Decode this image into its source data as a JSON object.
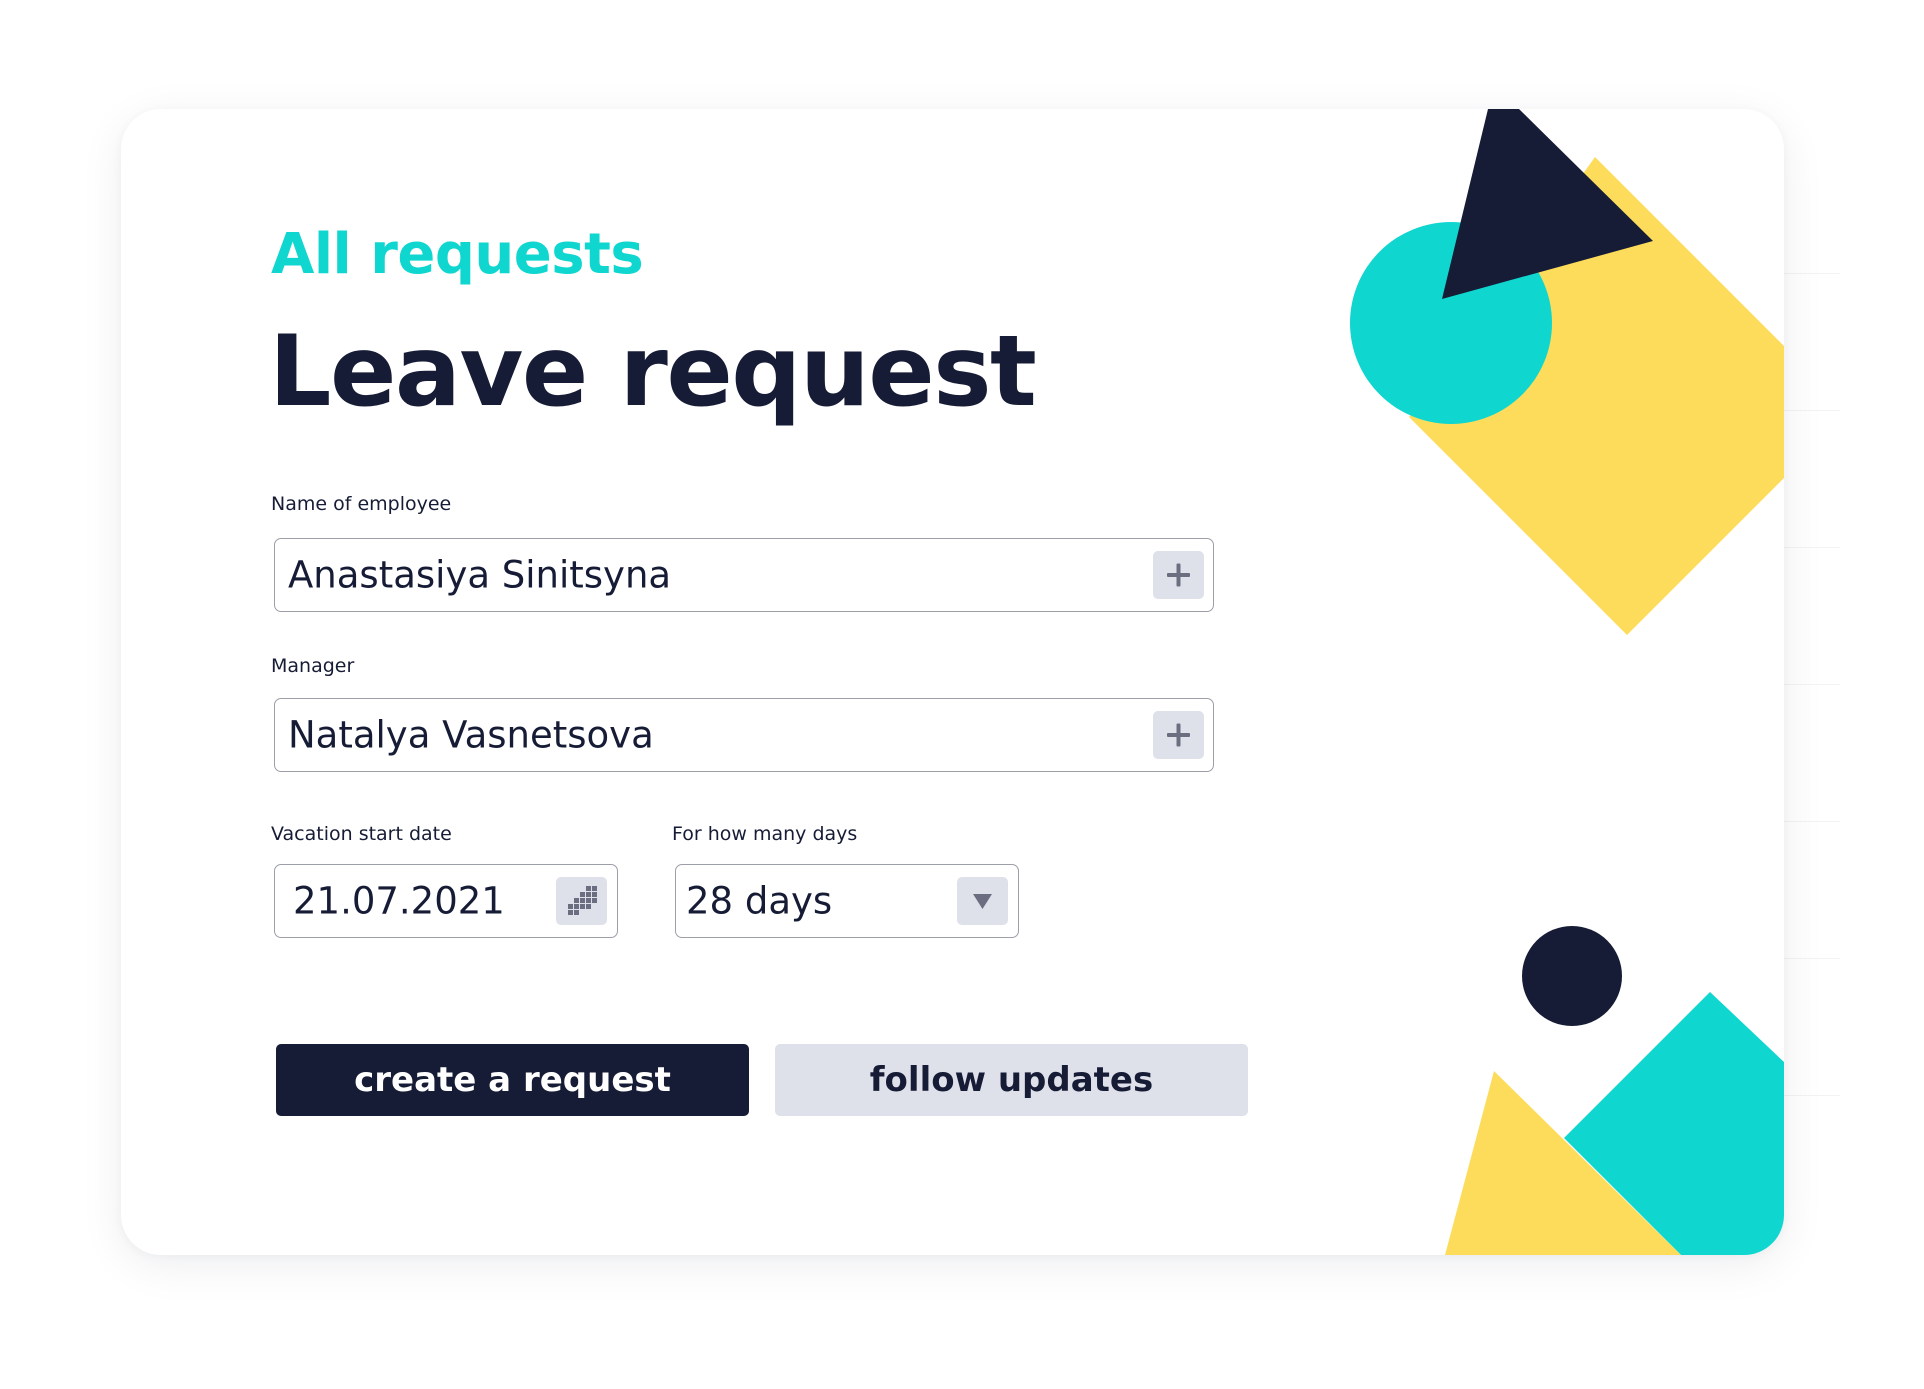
{
  "breadcrumb": "All requests",
  "title": "Leave request",
  "form": {
    "employee": {
      "label": "Name of employee",
      "value": "Anastasiya Sinitsyna",
      "button_icon": "plus-icon"
    },
    "manager": {
      "label": "Manager",
      "value": "Natalya Vasnetsova",
      "button_icon": "plus-icon"
    },
    "start_date": {
      "label": "Vacation start date",
      "value": "21.07.2021",
      "button_icon": "calendar-icon"
    },
    "duration": {
      "label": "For how many days",
      "value": "28 days",
      "button_icon": "triangle-down-icon"
    }
  },
  "buttons": {
    "create": "create a request",
    "follow": "follow updates"
  },
  "colors": {
    "navy": "#171c36",
    "teal": "#10d6d0",
    "yellow": "#fddc5c",
    "button_gray": "#dfe1ea",
    "border_gray": "#9c9ea8"
  }
}
